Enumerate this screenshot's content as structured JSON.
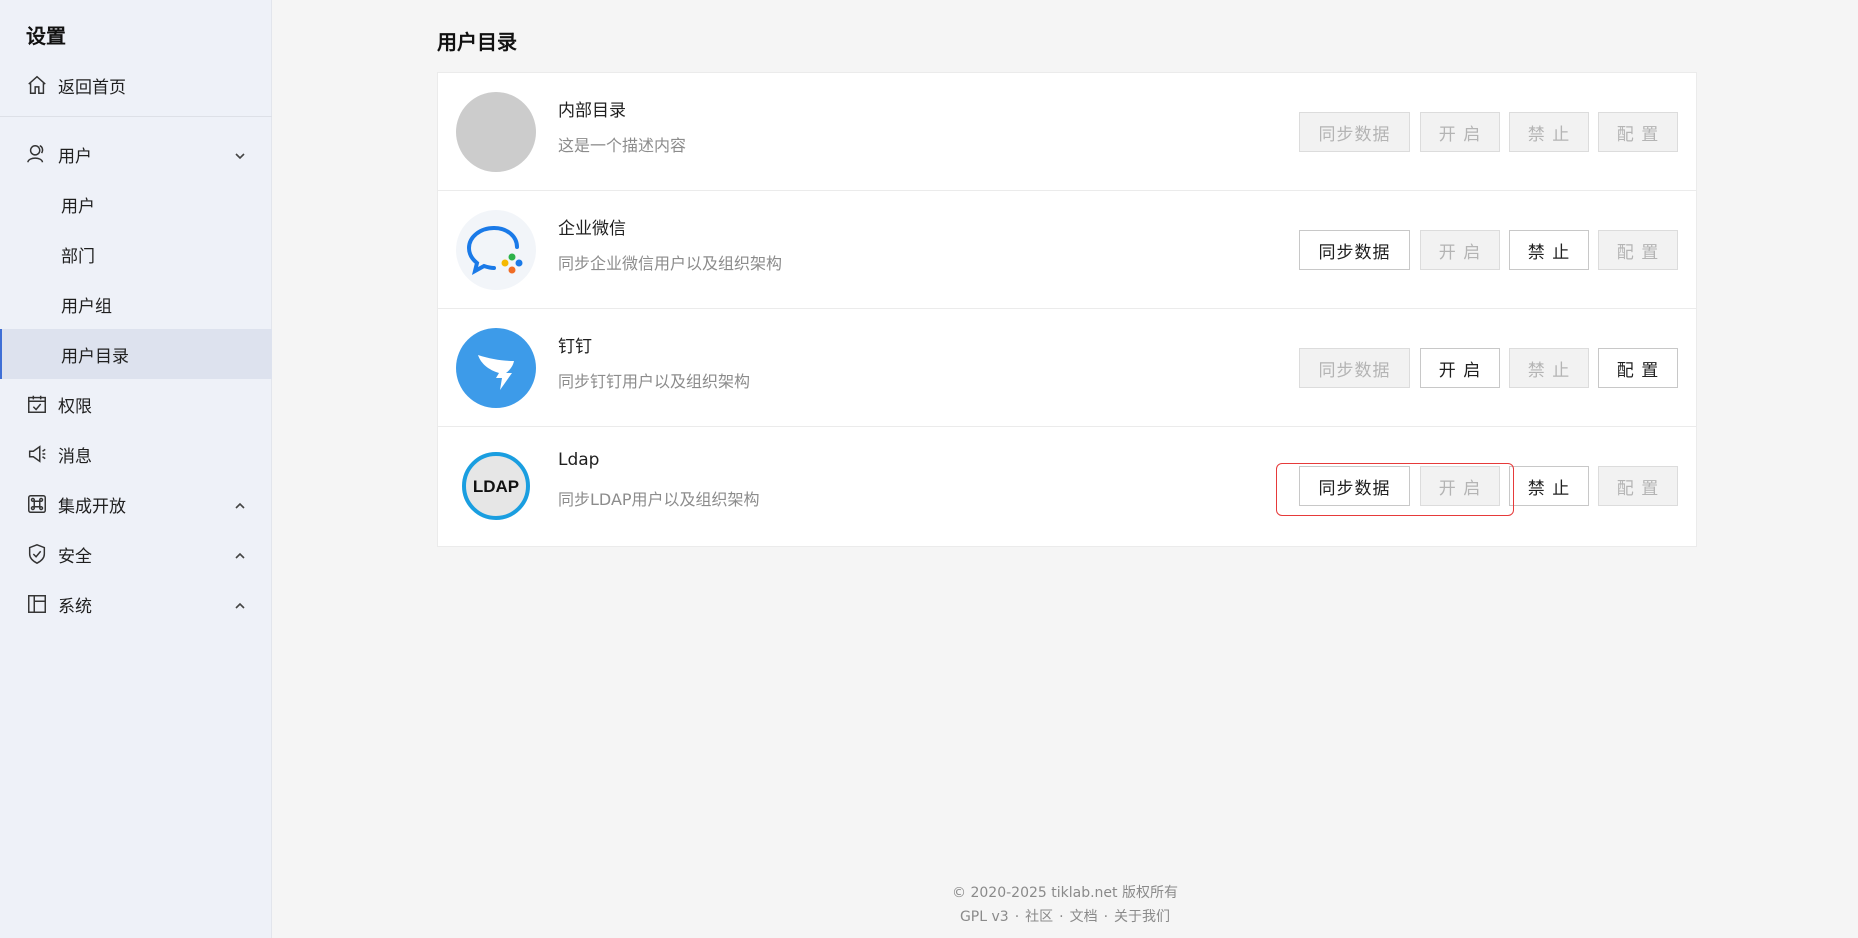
{
  "sidebar": {
    "title": "设置",
    "home": "返回首页",
    "user_group": "用户",
    "sub_items": [
      "用户",
      "部门",
      "用户组",
      "用户目录"
    ],
    "permissions": "权限",
    "messages": "消息",
    "integration": "集成开放",
    "security": "安全",
    "system": "系统",
    "active_item": "用户目录"
  },
  "main": {
    "title": "用户目录",
    "directories": [
      {
        "name": "内部目录",
        "desc": "这是一个描述内容",
        "logo": "gray-circle",
        "buttons": {
          "sync": "同步数据",
          "open": "开 启",
          "ban": "禁 止",
          "config": "配 置"
        },
        "enabled": {
          "sync": false,
          "open": false,
          "ban": false,
          "config": false
        }
      },
      {
        "name": "企业微信",
        "desc": "同步企业微信用户以及组织架构",
        "logo": "wecom-icon",
        "buttons": {
          "sync": "同步数据",
          "open": "开 启",
          "ban": "禁 止",
          "config": "配 置"
        },
        "enabled": {
          "sync": true,
          "open": false,
          "ban": true,
          "config": false
        }
      },
      {
        "name": "钉钉",
        "desc": "同步钉钉用户以及组织架构",
        "logo": "dingtalk-icon",
        "buttons": {
          "sync": "同步数据",
          "open": "开 启",
          "ban": "禁 止",
          "config": "配 置"
        },
        "enabled": {
          "sync": false,
          "open": true,
          "ban": false,
          "config": true
        }
      },
      {
        "name": "Ldap",
        "desc": "同步LDAP用户以及组织架构",
        "logo": "ldap-icon",
        "logo_text": "LDAP",
        "buttons": {
          "sync": "同步数据",
          "open": "开 启",
          "ban": "禁 止",
          "config": "配 置"
        },
        "enabled": {
          "sync": true,
          "open": false,
          "ban": true,
          "config": false
        }
      }
    ]
  },
  "footer": {
    "copyright": "© 2020-2025 tiklab.net 版权所有",
    "license": "GPL v3",
    "community": "社区",
    "docs": "文档",
    "about": "关于我们",
    "separator": "·"
  },
  "colors": {
    "accent": "#3f6fd6",
    "highlight": "#e63a3a",
    "sidebar_bg": "#eef1f8",
    "wecom_blue": "#1a7ae8",
    "dingtalk_blue": "#3d9be9"
  }
}
